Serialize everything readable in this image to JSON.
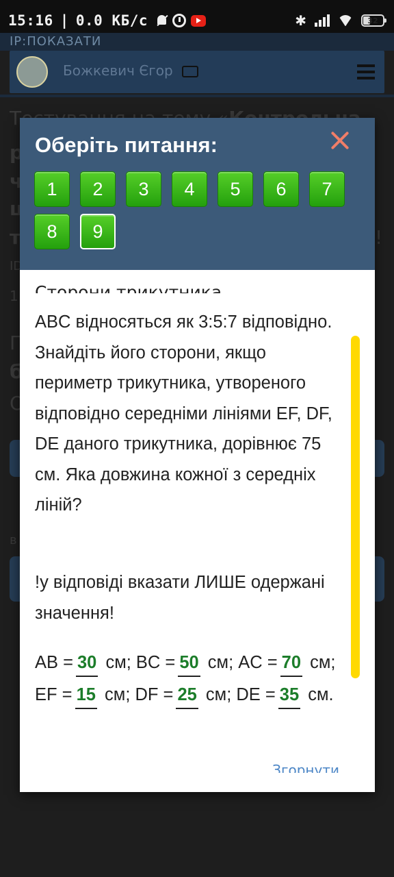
{
  "status_bar": {
    "time": "15:16",
    "separator": "|",
    "speed": "0.0 КБ/с",
    "battery": "32"
  },
  "background": {
    "ip_label": "IP:ПОКАЗАТИ",
    "user_name": "Божкевич Єгор",
    "test_title_start": "Тестування на тему «",
    "test_title_bold": "Контрольна",
    "frag_p": "р",
    "frag_ch": "ч",
    "frag_c": "ц",
    "frag_t": "т",
    "frag_excl": "!",
    "frag_id": "ID",
    "frag_1": "1",
    "frag_p2": "П",
    "frag_b": "б",
    "frag_o": "О",
    "frag_v": "в"
  },
  "modal": {
    "title": "Оберіть питання:",
    "questions": [
      "1",
      "2",
      "3",
      "4",
      "5",
      "6",
      "7",
      "8",
      "9"
    ],
    "active_question": "9",
    "question_cut_line": "Сторони трикутника",
    "question_text": "ABC відносяться як 3:5:7 відповідно. Знайдіть його сторони, якщо периметр трикутника, утвореного відповідно середніми лініями EF, DF, DE даного трикутника, дорівнює 75 см. Яка довжина кожної з середніх ліній?",
    "note": "!у відповіді вказати ЛИШЕ одержані значення!",
    "answer": {
      "ab_label": "AB =",
      "ab_value": "30",
      "bc_label": "см; BC =",
      "bc_value": "50",
      "ac_label": "см; AC =",
      "ac_value": "70",
      "ef_label": "см; EF =",
      "ef_value": "15",
      "df_label": "см; DF =",
      "df_value": "25",
      "de_label": "см; DE =",
      "de_value": "35",
      "end_label": "см."
    },
    "collapse_label": "Згорнути"
  },
  "colors": {
    "modal_header": "#3c5a79",
    "question_button": "#3cb81a",
    "answer_text": "#1c7d2a",
    "scrollbar": "#ffd900",
    "close_icon": "#f07e68"
  }
}
